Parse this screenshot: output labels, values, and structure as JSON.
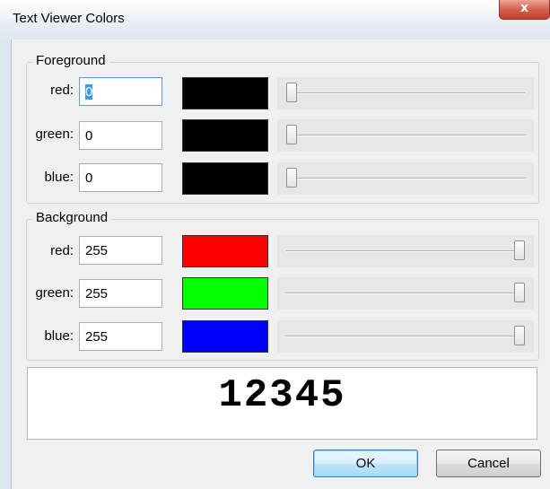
{
  "window": {
    "title": "Text Viewer Colors",
    "close_glyph": "x"
  },
  "foreground": {
    "legend": "Foreground",
    "channels": [
      {
        "label": "red:",
        "value": "0",
        "swatch_color": "#000000",
        "level": 0
      },
      {
        "label": "green:",
        "value": "0",
        "swatch_color": "#000000",
        "level": 0
      },
      {
        "label": "blue:",
        "value": "0",
        "swatch_color": "#000000",
        "level": 0
      }
    ]
  },
  "background": {
    "legend": "Background",
    "channels": [
      {
        "label": "red:",
        "value": "255",
        "swatch_color": "#ff0000",
        "level": 255
      },
      {
        "label": "green:",
        "value": "255",
        "swatch_color": "#00ff00",
        "level": 255
      },
      {
        "label": "blue:",
        "value": "255",
        "swatch_color": "#0000ff",
        "level": 255
      }
    ]
  },
  "preview": {
    "text": "12345"
  },
  "buttons": {
    "ok_label": "OK",
    "cancel_label": "Cancel"
  }
}
